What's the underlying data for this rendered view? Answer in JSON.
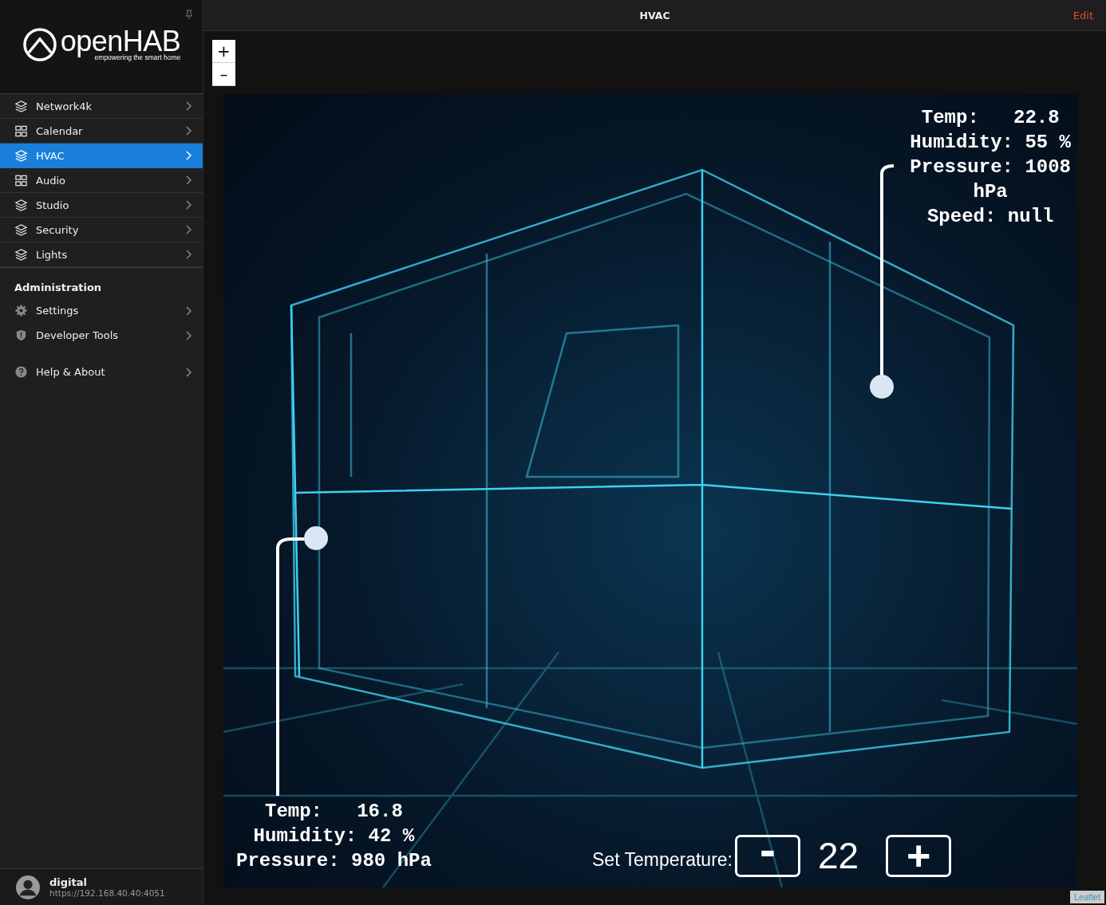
{
  "sidebar": {
    "logo": {
      "name": "openHAB",
      "tagline": "empowering the smart home"
    },
    "pages": [
      {
        "label": "Network4k",
        "kind": "layers",
        "selected": false
      },
      {
        "label": "Calendar",
        "kind": "grid",
        "selected": false
      },
      {
        "label": "HVAC",
        "kind": "layers",
        "selected": true
      },
      {
        "label": "Audio",
        "kind": "grid",
        "selected": false
      },
      {
        "label": "Studio",
        "kind": "layers",
        "selected": false
      },
      {
        "label": "Security",
        "kind": "layers",
        "selected": false
      },
      {
        "label": "Lights",
        "kind": "layers",
        "selected": false
      }
    ],
    "admin": {
      "heading": "Administration",
      "items": [
        {
          "label": "Settings",
          "kind": "gear"
        },
        {
          "label": "Developer Tools",
          "kind": "shield"
        }
      ]
    },
    "help": {
      "label": "Help & About"
    },
    "user": {
      "name": "digital",
      "url": "https://192.168.40.40:4051"
    }
  },
  "page": {
    "title": "HVAC",
    "edit": "Edit"
  },
  "map": {
    "zoom_in": "+",
    "zoom_out": "–",
    "attribution": "Leaflet",
    "sensors": [
      {
        "lines": [
          "Temp:   22.8",
          "Humidity: 55 %",
          "Pressure: 1008",
          "hPa",
          "Speed: null"
        ]
      },
      {
        "lines": [
          "Temp:   16.8",
          "Humidity: 42 %",
          "Pressure: 980 hPa"
        ]
      }
    ],
    "setpoint": {
      "label": "Set Temperature:",
      "decrease": "-",
      "value": "22",
      "increase": "+"
    }
  }
}
